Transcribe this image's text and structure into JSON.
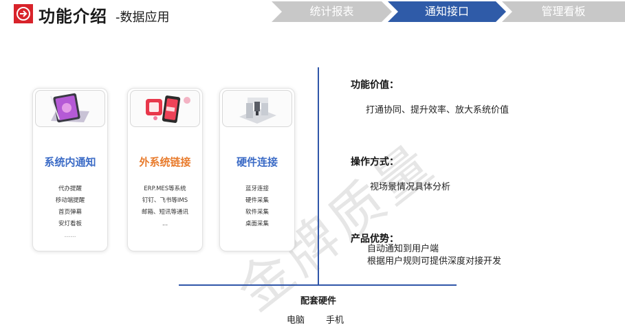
{
  "header": {
    "title": "功能介绍",
    "subtitle": "-数据应用",
    "icon": "circle-arrow-right-icon",
    "accent": "#d8232a"
  },
  "tabs": [
    {
      "label": "统计报表",
      "active": false
    },
    {
      "label": "通知接口",
      "active": true
    },
    {
      "label": "管理看板",
      "active": false
    }
  ],
  "tab_colors": {
    "inactive": "#c8c8c8",
    "active": "#2f5ba8"
  },
  "cards": [
    {
      "title": "系统内通知",
      "title_color": "#3b6bc6",
      "icon": "tablet-icon",
      "lines": [
        "代办提醒",
        "移动端提醒",
        "首页弹幕",
        "安灯看板",
        "……"
      ]
    },
    {
      "title": "外系统链接",
      "title_color": "#e87b2c",
      "icon": "phone-app-icon",
      "lines": [
        "ERP.MES等系统",
        "钉钉、飞书等IMS",
        "邮箱、短讯等通讯",
        "..."
      ]
    },
    {
      "title": "硬件连接",
      "title_color": "#3b6bc6",
      "icon": "hardware-machine-icon",
      "lines": [
        "蓝牙连接",
        "硬件采集",
        "软件采集",
        "桌面采集"
      ]
    }
  ],
  "watermark": "金牌质量",
  "sections": {
    "value_head": "功能价值：",
    "value_text": "打通协同、提升效率、放大系统价值",
    "method_head": "操作方式：",
    "method_text": "视场景情况具体分析",
    "advantage_head": "产品优势：",
    "advantage_lines": [
      "自动通知到用户端",
      "根据用户规则可提供深度对接开发"
    ]
  },
  "hardware": {
    "head": "配套硬件",
    "items": [
      "电脑",
      "手机"
    ]
  }
}
